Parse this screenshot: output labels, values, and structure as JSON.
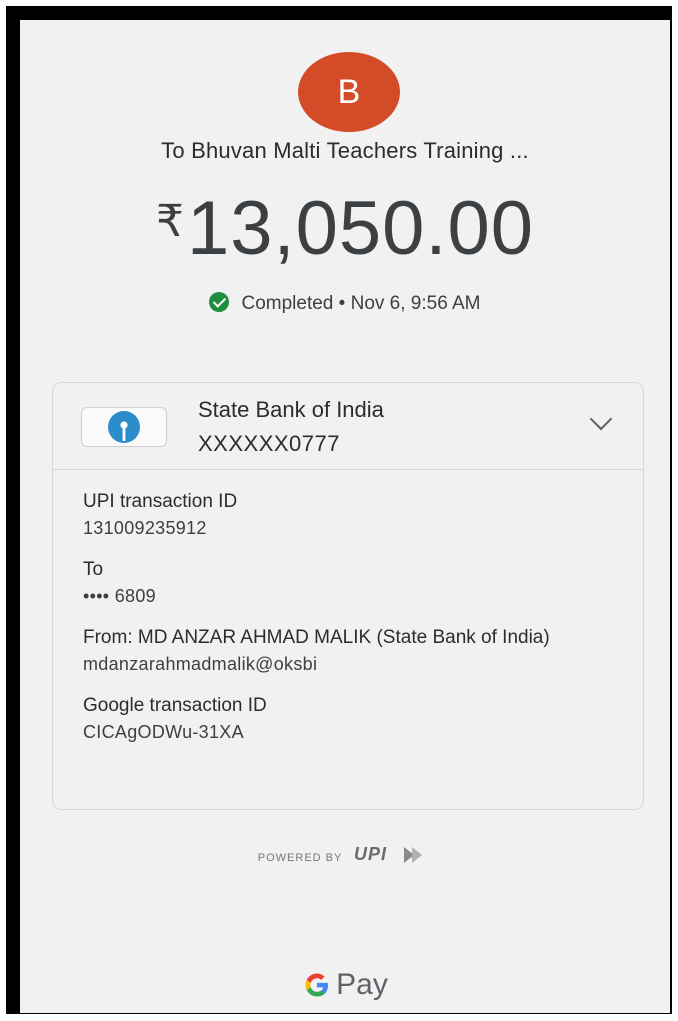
{
  "header": {
    "avatar_letter": "B",
    "payee": "To Bhuvan Malti Teachers Training ...",
    "currency_symbol": "₹",
    "amount": "13,050.00",
    "status": "Completed",
    "separator": "•",
    "datetime": "Nov 6, 9:56 AM"
  },
  "bank": {
    "name": "State Bank of India",
    "account": "XXXXXX0777"
  },
  "details": [
    {
      "label": "UPI transaction ID",
      "value": "131009235912"
    },
    {
      "label": "To",
      "value": "•••• 6809"
    },
    {
      "label": "From: MD ANZAR AHMAD  MALIK (State Bank of India)",
      "value": "mdanzarahmadmalik@oksbi"
    },
    {
      "label": "Google transaction ID",
      "value": "CICAgODWu-31XA"
    }
  ],
  "footer": {
    "powered_by": "POWERED BY",
    "upi_logo_text": "UPI",
    "gpay_label": "Pay"
  },
  "colors": {
    "avatar": "#d34b27",
    "success": "#1e8e3e",
    "sbi_blue": "#2b8dc9"
  }
}
